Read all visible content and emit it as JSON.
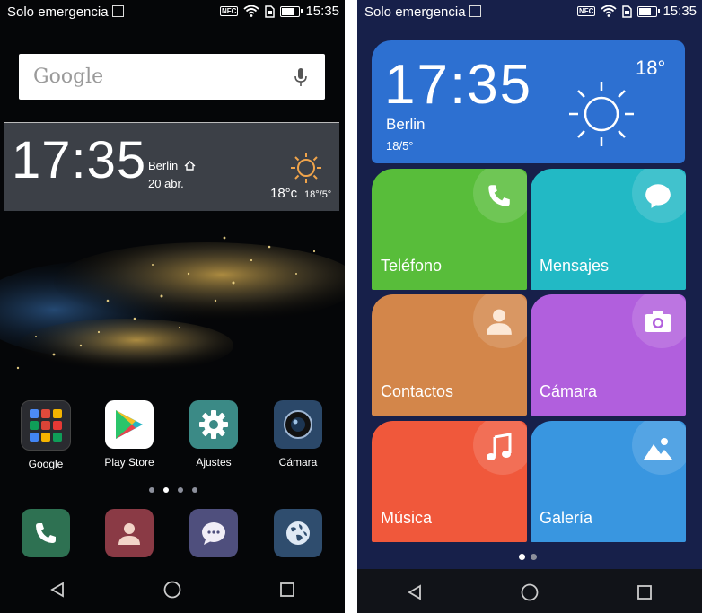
{
  "left_phone": {
    "status": {
      "carrier": "Solo emergencia",
      "nfc": "NFC",
      "time": "15:35"
    },
    "search": {
      "label": "Google"
    },
    "clock_widget": {
      "time": "17:35",
      "city": "Berlin",
      "date": "20 abr.",
      "temp": "18°c",
      "range": "18°/5°"
    },
    "apps": [
      {
        "label": "Google"
      },
      {
        "label": "Play Store"
      },
      {
        "label": "Ajustes"
      },
      {
        "label": "Cámara"
      }
    ],
    "page_dots": {
      "count": 4,
      "active": 1
    }
  },
  "right_phone": {
    "status": {
      "carrier": "Solo emergencia",
      "nfc": "NFC",
      "time": "15:35"
    },
    "clock_widget": {
      "time": "17:35",
      "city": "Berlin",
      "range": "18/5°",
      "temp": "18°"
    },
    "tiles": [
      {
        "label": "Teléfono",
        "color": "#58bd3a"
      },
      {
        "label": "Mensajes",
        "color": "#22b9c5"
      },
      {
        "label": "Contactos",
        "color": "#d3864a"
      },
      {
        "label": "Cámara",
        "color": "#b15fdd"
      },
      {
        "label": "Música",
        "color": "#f0583b"
      },
      {
        "label": "Galería",
        "color": "#3996e0"
      }
    ],
    "page_dots": {
      "count": 2,
      "active": 0
    }
  }
}
